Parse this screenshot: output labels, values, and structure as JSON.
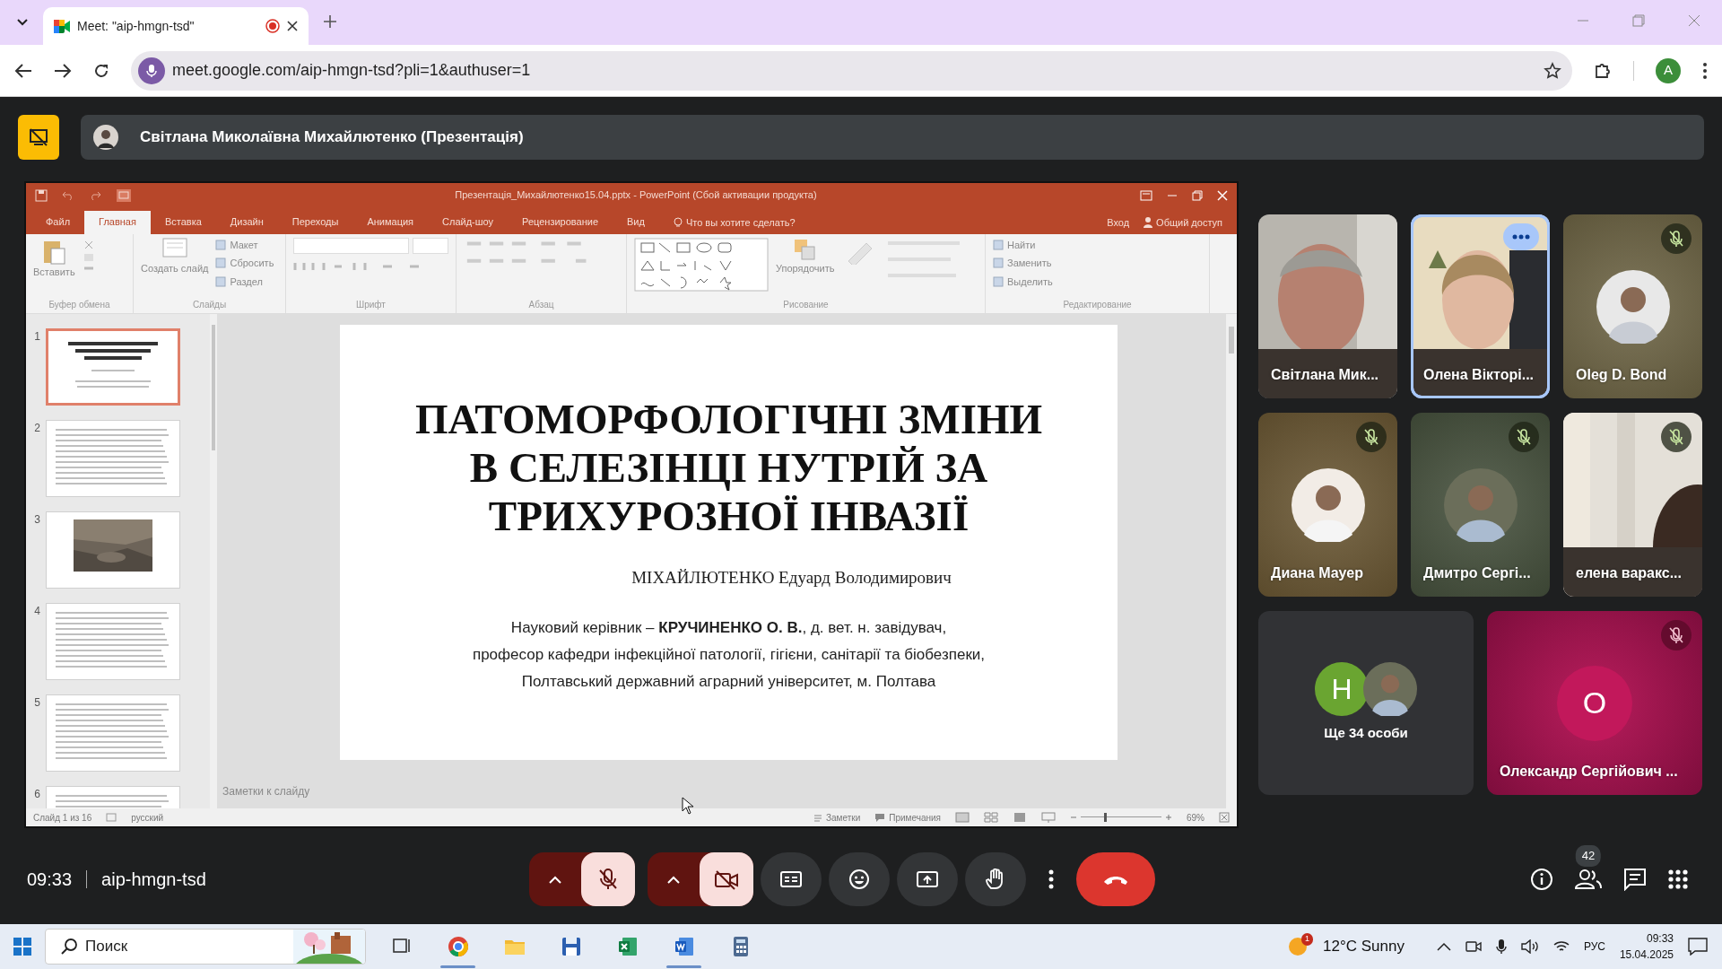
{
  "browser": {
    "tab": {
      "title": "Meet: \"aip-hmgn-tsd\"",
      "recording": true
    },
    "address": "meet.google.com/aip-hmgn-tsd?pli=1&authuser=1",
    "profile_initial": "A"
  },
  "presenter_bar": {
    "name": "Світлана Миколаївна Михайлютенко (Презентація)"
  },
  "powerpoint": {
    "title": "Презентація_Михайлютенко15.04.pptx - PowerPoint (Сбой активации продукта)",
    "menu_tabs": [
      {
        "label": "Файл",
        "selected": false
      },
      {
        "label": "Главная",
        "selected": true
      },
      {
        "label": "Вставка",
        "selected": false
      },
      {
        "label": "Дизайн",
        "selected": false
      },
      {
        "label": "Переходы",
        "selected": false
      },
      {
        "label": "Анимация",
        "selected": false
      },
      {
        "label": "Слайд-шоу",
        "selected": false
      },
      {
        "label": "Рецензирование",
        "selected": false
      },
      {
        "label": "Вид",
        "selected": false
      }
    ],
    "search_hint": "Что вы хотите сделать?",
    "sign_in": "Вход",
    "share": "Общий доступ",
    "ribbon_groups": [
      {
        "kind": "clipboard",
        "label": "Буфер обмена",
        "commands": [
          "Вставить"
        ]
      },
      {
        "kind": "slides",
        "label": "Слайды",
        "commands": [
          "Создать слайд",
          "Макет",
          "Сбросить",
          "Раздел"
        ]
      },
      {
        "kind": "font",
        "label": "Шрифт"
      },
      {
        "kind": "paragraph",
        "label": "Абзац"
      },
      {
        "kind": "drawing",
        "label": "Рисование",
        "commands": [
          "Упорядочить"
        ]
      },
      {
        "kind": "editing",
        "label": "Редактирование",
        "commands": [
          "Найти",
          "Заменить",
          "Выделить"
        ]
      }
    ],
    "thumbnails": [
      {
        "number": "1",
        "selected": true,
        "kind": "title"
      },
      {
        "number": "2",
        "selected": false,
        "kind": "text"
      },
      {
        "number": "3",
        "selected": false,
        "kind": "picture"
      },
      {
        "number": "4",
        "selected": false,
        "kind": "text"
      },
      {
        "number": "5",
        "selected": false,
        "kind": "text"
      },
      {
        "number": "6",
        "selected": false,
        "kind": "text"
      }
    ],
    "slide": {
      "title_lines": [
        "ПАТОМОРФОЛОГІЧНІ ЗМІНИ",
        "В СЕЛЕЗІНЦІ НУТРІЙ ЗА",
        "ТРИХУРОЗНОЇ ІНВАЗІЇ"
      ],
      "author": "МІХАЙЛЮТЕНКО Едуард Володимирович",
      "supervisor_lines": [
        "Науковий керівник – **КРУЧИНЕНКО О. В.**, д. вет. н. завідувач,",
        "професор кафедри інфекційної патології, гігієни, санітарії та біобезпеки,",
        "Полтавський державний аграрний університет, м. Полтава"
      ]
    },
    "notes_placeholder": "Заметки к слайду",
    "status": {
      "slide_counter": "Слайд 1 из 16",
      "language": "русский",
      "notes": "Заметки",
      "comments": "Примечания",
      "zoom": "69%",
      "zoom_slider": {
        "level": 0.3
      }
    }
  },
  "participants": [
    {
      "name": "Світлана Мик...",
      "kind": "video",
      "muted": false,
      "highlighted": false
    },
    {
      "name": "Олена Вікторі...",
      "kind": "video",
      "muted": false,
      "highlighted": true
    },
    {
      "name": "Oleg D. Bond",
      "kind": "avatar",
      "muted": true,
      "highlighted": false
    },
    {
      "name": "Диана Мауер",
      "kind": "avatar",
      "muted": true,
      "highlighted": false
    },
    {
      "name": "Дмитро Сергі...",
      "kind": "avatar",
      "muted": true,
      "highlighted": false
    },
    {
      "name": "елена варакс...",
      "kind": "video",
      "muted": true,
      "highlighted": false
    }
  ],
  "others": {
    "initial": "Н",
    "label": "Ще 34 особи"
  },
  "featured": {
    "name": "Олександр Сергійович ...",
    "initial": "О",
    "muted": true
  },
  "meeting": {
    "time": "09:33",
    "code": "aip-hmgn-tsd",
    "mic_on": false,
    "camera_on": false,
    "people_count": "42"
  },
  "taskbar": {
    "search_placeholder": "Поиск",
    "apps": [
      {
        "kind": "taskview",
        "running": false
      },
      {
        "kind": "chrome",
        "running": true
      },
      {
        "kind": "folder",
        "running": false
      },
      {
        "kind": "save",
        "running": false
      },
      {
        "kind": "spreadsheet",
        "running": false
      },
      {
        "kind": "document",
        "running": true
      },
      {
        "kind": "calculator",
        "running": false
      }
    ],
    "weather_badge": "1",
    "weather": "12°C Sunny",
    "language": "РУС",
    "time": "09:33",
    "date": "15.04.2025"
  }
}
